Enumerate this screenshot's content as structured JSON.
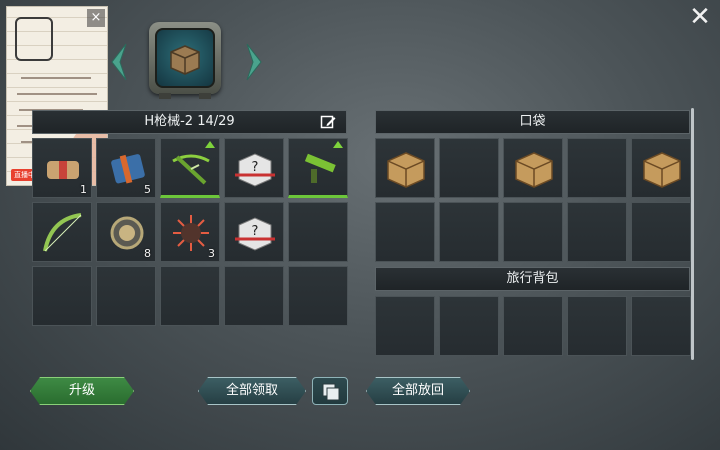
{
  "pip": {
    "close_label": "×",
    "badge": "直播中"
  },
  "container": {
    "title": "H枪械-2 14/29"
  },
  "nav": {
    "prev_icon": "chevron-left-icon",
    "next_icon": "chevron-right-icon",
    "center_icon": "wooden-crate-icon"
  },
  "main_grid": {
    "items": [
      {
        "name": "bandage-pack",
        "qty": "1"
      },
      {
        "name": "blue-supply-bundle",
        "qty": "5"
      },
      {
        "name": "crossbow",
        "qty": "",
        "upgrade": true
      },
      {
        "name": "mystery-box",
        "qty": ""
      },
      {
        "name": "green-rifle",
        "qty": "",
        "upgrade": true
      },
      {
        "name": "recurve-bow",
        "qty": ""
      },
      {
        "name": "compass",
        "qty": "8"
      },
      {
        "name": "spiked-mine",
        "qty": "3"
      },
      {
        "name": "mystery-box",
        "qty": ""
      }
    ]
  },
  "pocket": {
    "title": "口袋",
    "items": [
      "wooden-crate",
      "",
      "wooden-crate",
      "",
      "wooden-crate"
    ]
  },
  "backpack": {
    "title": "旅行背包"
  },
  "buttons": {
    "upgrade": "升级",
    "take_all": "全部领取",
    "put_all": "全部放回"
  },
  "colors": {
    "accent_green": "#6cc63a",
    "button_green": "#2f7a35",
    "button_teal": "#2f4d52"
  }
}
